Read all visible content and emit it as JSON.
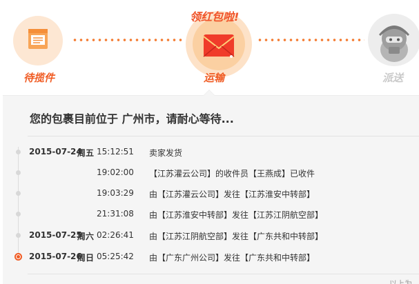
{
  "steps": {
    "banner": "领红包啦!",
    "items": [
      {
        "label": "待揽件",
        "icon": "package-icon",
        "state": "done"
      },
      {
        "label": "运输",
        "icon": "envelope-icon",
        "state": "current"
      },
      {
        "label": "派送",
        "icon": "courier-icon",
        "state": "pending"
      }
    ]
  },
  "panel": {
    "headline": "您的包裹目前位于 广州市，请耐心等待...",
    "more": "以上为",
    "records": [
      {
        "date": "2015-07-24",
        "day": "周五",
        "time": "15:12:51",
        "desc": "卖家发货"
      },
      {
        "date": "",
        "day": "",
        "time": "19:02:00",
        "desc": "【江苏灌云公司】的收件员【王燕成】已收件"
      },
      {
        "date": "",
        "day": "",
        "time": "19:03:29",
        "desc": "由【江苏灌云公司】发往【江苏淮安中转部】"
      },
      {
        "date": "",
        "day": "",
        "time": "21:31:08",
        "desc": "由【江苏淮安中转部】发往【江苏江阴航空部】"
      },
      {
        "date": "2015-07-25",
        "day": "周六",
        "time": "02:26:41",
        "desc": "由【江苏江阴航空部】发往【广东共和中转部】"
      },
      {
        "date": "2015-07-26",
        "day": "周日",
        "time": "05:25:42",
        "desc": "由【广东广州公司】发往【广东共和中转部】"
      }
    ]
  },
  "colors": {
    "accent": "#f05c24",
    "pending": "#c9c9c9",
    "panel_bg": "#f5f5f5"
  }
}
